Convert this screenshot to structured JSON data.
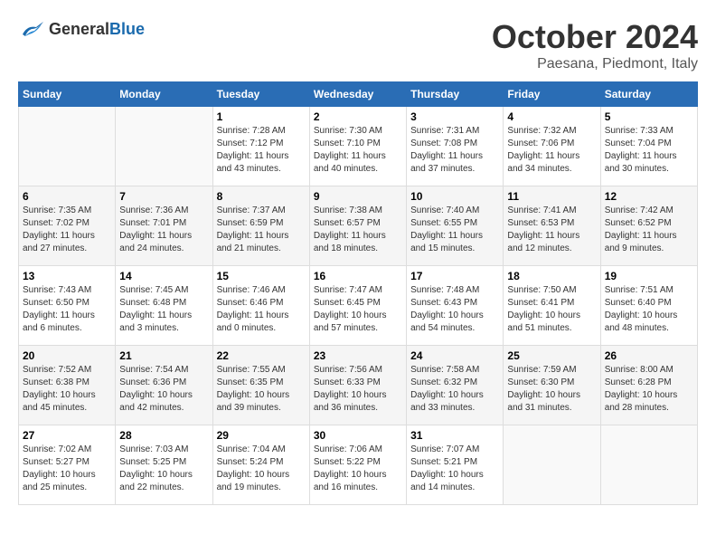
{
  "logo": {
    "general": "General",
    "blue": "Blue"
  },
  "header": {
    "month": "October 2024",
    "location": "Paesana, Piedmont, Italy"
  },
  "weekdays": [
    "Sunday",
    "Monday",
    "Tuesday",
    "Wednesday",
    "Thursday",
    "Friday",
    "Saturday"
  ],
  "weeks": [
    [
      {
        "day": null
      },
      {
        "day": null
      },
      {
        "day": "1",
        "sunrise": "Sunrise: 7:28 AM",
        "sunset": "Sunset: 7:12 PM",
        "daylight": "Daylight: 11 hours and 43 minutes."
      },
      {
        "day": "2",
        "sunrise": "Sunrise: 7:30 AM",
        "sunset": "Sunset: 7:10 PM",
        "daylight": "Daylight: 11 hours and 40 minutes."
      },
      {
        "day": "3",
        "sunrise": "Sunrise: 7:31 AM",
        "sunset": "Sunset: 7:08 PM",
        "daylight": "Daylight: 11 hours and 37 minutes."
      },
      {
        "day": "4",
        "sunrise": "Sunrise: 7:32 AM",
        "sunset": "Sunset: 7:06 PM",
        "daylight": "Daylight: 11 hours and 34 minutes."
      },
      {
        "day": "5",
        "sunrise": "Sunrise: 7:33 AM",
        "sunset": "Sunset: 7:04 PM",
        "daylight": "Daylight: 11 hours and 30 minutes."
      }
    ],
    [
      {
        "day": "6",
        "sunrise": "Sunrise: 7:35 AM",
        "sunset": "Sunset: 7:02 PM",
        "daylight": "Daylight: 11 hours and 27 minutes."
      },
      {
        "day": "7",
        "sunrise": "Sunrise: 7:36 AM",
        "sunset": "Sunset: 7:01 PM",
        "daylight": "Daylight: 11 hours and 24 minutes."
      },
      {
        "day": "8",
        "sunrise": "Sunrise: 7:37 AM",
        "sunset": "Sunset: 6:59 PM",
        "daylight": "Daylight: 11 hours and 21 minutes."
      },
      {
        "day": "9",
        "sunrise": "Sunrise: 7:38 AM",
        "sunset": "Sunset: 6:57 PM",
        "daylight": "Daylight: 11 hours and 18 minutes."
      },
      {
        "day": "10",
        "sunrise": "Sunrise: 7:40 AM",
        "sunset": "Sunset: 6:55 PM",
        "daylight": "Daylight: 11 hours and 15 minutes."
      },
      {
        "day": "11",
        "sunrise": "Sunrise: 7:41 AM",
        "sunset": "Sunset: 6:53 PM",
        "daylight": "Daylight: 11 hours and 12 minutes."
      },
      {
        "day": "12",
        "sunrise": "Sunrise: 7:42 AM",
        "sunset": "Sunset: 6:52 PM",
        "daylight": "Daylight: 11 hours and 9 minutes."
      }
    ],
    [
      {
        "day": "13",
        "sunrise": "Sunrise: 7:43 AM",
        "sunset": "Sunset: 6:50 PM",
        "daylight": "Daylight: 11 hours and 6 minutes."
      },
      {
        "day": "14",
        "sunrise": "Sunrise: 7:45 AM",
        "sunset": "Sunset: 6:48 PM",
        "daylight": "Daylight: 11 hours and 3 minutes."
      },
      {
        "day": "15",
        "sunrise": "Sunrise: 7:46 AM",
        "sunset": "Sunset: 6:46 PM",
        "daylight": "Daylight: 11 hours and 0 minutes."
      },
      {
        "day": "16",
        "sunrise": "Sunrise: 7:47 AM",
        "sunset": "Sunset: 6:45 PM",
        "daylight": "Daylight: 10 hours and 57 minutes."
      },
      {
        "day": "17",
        "sunrise": "Sunrise: 7:48 AM",
        "sunset": "Sunset: 6:43 PM",
        "daylight": "Daylight: 10 hours and 54 minutes."
      },
      {
        "day": "18",
        "sunrise": "Sunrise: 7:50 AM",
        "sunset": "Sunset: 6:41 PM",
        "daylight": "Daylight: 10 hours and 51 minutes."
      },
      {
        "day": "19",
        "sunrise": "Sunrise: 7:51 AM",
        "sunset": "Sunset: 6:40 PM",
        "daylight": "Daylight: 10 hours and 48 minutes."
      }
    ],
    [
      {
        "day": "20",
        "sunrise": "Sunrise: 7:52 AM",
        "sunset": "Sunset: 6:38 PM",
        "daylight": "Daylight: 10 hours and 45 minutes."
      },
      {
        "day": "21",
        "sunrise": "Sunrise: 7:54 AM",
        "sunset": "Sunset: 6:36 PM",
        "daylight": "Daylight: 10 hours and 42 minutes."
      },
      {
        "day": "22",
        "sunrise": "Sunrise: 7:55 AM",
        "sunset": "Sunset: 6:35 PM",
        "daylight": "Daylight: 10 hours and 39 minutes."
      },
      {
        "day": "23",
        "sunrise": "Sunrise: 7:56 AM",
        "sunset": "Sunset: 6:33 PM",
        "daylight": "Daylight: 10 hours and 36 minutes."
      },
      {
        "day": "24",
        "sunrise": "Sunrise: 7:58 AM",
        "sunset": "Sunset: 6:32 PM",
        "daylight": "Daylight: 10 hours and 33 minutes."
      },
      {
        "day": "25",
        "sunrise": "Sunrise: 7:59 AM",
        "sunset": "Sunset: 6:30 PM",
        "daylight": "Daylight: 10 hours and 31 minutes."
      },
      {
        "day": "26",
        "sunrise": "Sunrise: 8:00 AM",
        "sunset": "Sunset: 6:28 PM",
        "daylight": "Daylight: 10 hours and 28 minutes."
      }
    ],
    [
      {
        "day": "27",
        "sunrise": "Sunrise: 7:02 AM",
        "sunset": "Sunset: 5:27 PM",
        "daylight": "Daylight: 10 hours and 25 minutes."
      },
      {
        "day": "28",
        "sunrise": "Sunrise: 7:03 AM",
        "sunset": "Sunset: 5:25 PM",
        "daylight": "Daylight: 10 hours and 22 minutes."
      },
      {
        "day": "29",
        "sunrise": "Sunrise: 7:04 AM",
        "sunset": "Sunset: 5:24 PM",
        "daylight": "Daylight: 10 hours and 19 minutes."
      },
      {
        "day": "30",
        "sunrise": "Sunrise: 7:06 AM",
        "sunset": "Sunset: 5:22 PM",
        "daylight": "Daylight: 10 hours and 16 minutes."
      },
      {
        "day": "31",
        "sunrise": "Sunrise: 7:07 AM",
        "sunset": "Sunset: 5:21 PM",
        "daylight": "Daylight: 10 hours and 14 minutes."
      },
      {
        "day": null
      },
      {
        "day": null
      }
    ]
  ]
}
